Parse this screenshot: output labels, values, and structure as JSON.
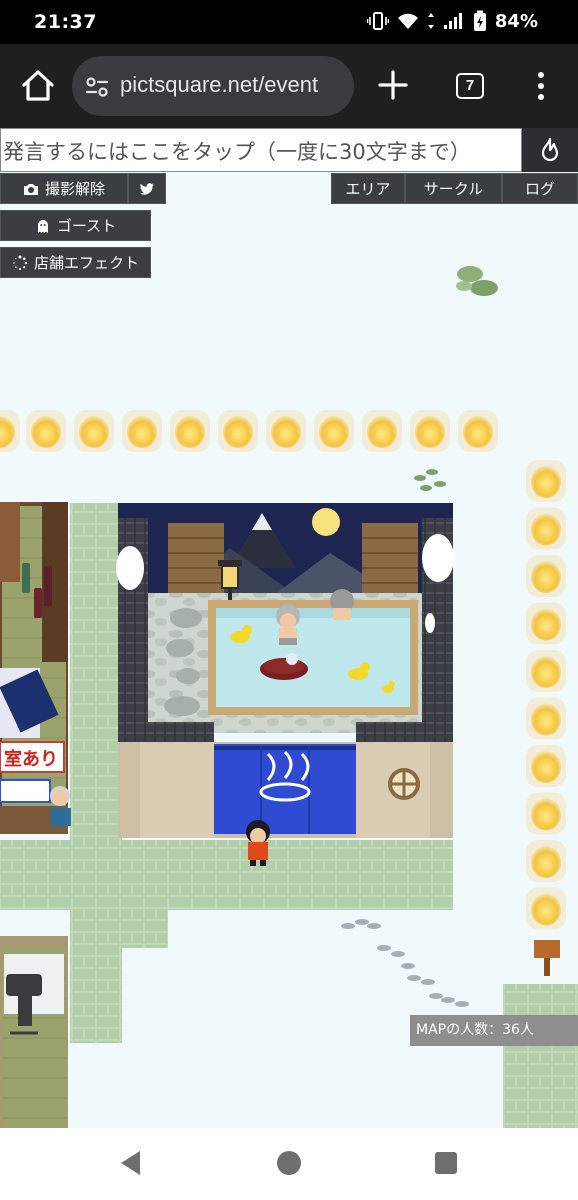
{
  "status_bar": {
    "time": "21:37",
    "battery": "84%"
  },
  "browser": {
    "url": "pictsquare.net/event",
    "tab_count": "7"
  },
  "game": {
    "chat_placeholder": "発言するにはここをタップ（一度に30文字まで）",
    "buttons": {
      "photo_release": "撮影解除",
      "ghost": "ゴースト",
      "shop_effect": "店舗エフェクト",
      "area": "エリア",
      "circle": "サークル",
      "log": "ログ"
    },
    "shop_sign": "室あり",
    "population": "MAPの人数：36人"
  },
  "colors": {
    "background": "#f0fafd",
    "button": "#3a3d42",
    "tile_green": "#b9d3ae",
    "noren_blue": "#2e4bd1",
    "water": "#bfe8ec",
    "night_sky": "#1d2550",
    "lantern": "#f4c53d"
  }
}
